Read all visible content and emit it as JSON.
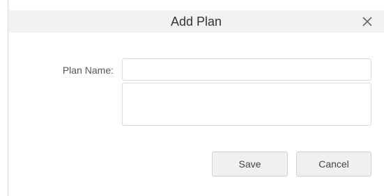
{
  "dialog": {
    "title": "Add Plan",
    "close_icon": "close-icon"
  },
  "form": {
    "plan_name_label": "Plan Name:",
    "plan_name_value": "",
    "plan_name_placeholder": "",
    "description_value": "",
    "description_placeholder": ""
  },
  "actions": {
    "save_label": "Save",
    "cancel_label": "Cancel"
  },
  "colors": {
    "header_background": "#f2f2f2",
    "border": "#d9d9d9",
    "button_background": "#f0f0f0"
  }
}
